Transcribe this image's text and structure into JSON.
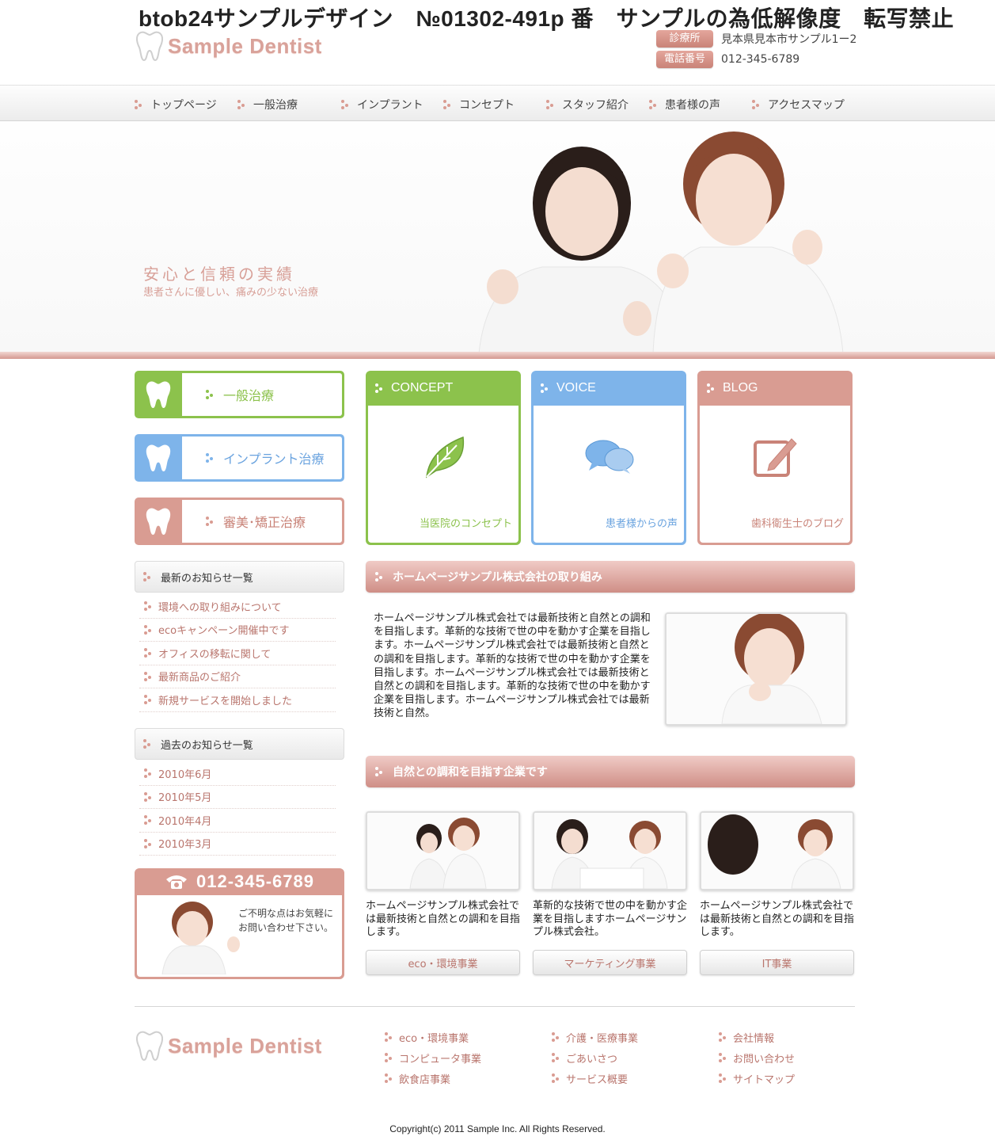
{
  "header": {
    "watermark_title": "btob24サンプルデザイン　№01302-491p 番　サンプルの為低解像度　転写禁止",
    "logo_text": "Sample Dentist",
    "clinic_label": "診療所",
    "clinic_address": "見本県見本市サンプル1ー2",
    "phone_label": "電話番号",
    "phone_number": "012-345-6789"
  },
  "nav": {
    "items": [
      "トップページ",
      "一般治療",
      "インプラント",
      "コンセプト",
      "スタッフ紹介",
      "患者様の声",
      "アクセスマップ"
    ]
  },
  "hero": {
    "title": "安心と信頼の実績",
    "subtitle": "患者さんに優しい、痛みの少ない治療"
  },
  "categories": [
    {
      "label": "一般治療",
      "color": "#8cc24c"
    },
    {
      "label": "インプラント治療",
      "color": "#7eb4ea"
    },
    {
      "label": "審美･矯正治療",
      "color": "#d99c92"
    }
  ],
  "cards": [
    {
      "title": "CONCEPT",
      "caption": "当医院のコンセプト",
      "color": "#8cc24c",
      "icon": "leaf-icon"
    },
    {
      "title": "VOICE",
      "caption": "患者様からの声",
      "color": "#7eb4ea",
      "icon": "chat-bubbles-icon"
    },
    {
      "title": "BLOG",
      "caption": "歯科衛生士のブログ",
      "color": "#d99c92",
      "icon": "edit-note-icon"
    }
  ],
  "news": {
    "latest_title": "最新のお知らせ一覧",
    "latest_items": [
      "環境への取り組みについて",
      "ecoキャンペーン開催中です",
      "オフィスの移転に関して",
      "最新商品のご紹介",
      "新規サービスを開始しました"
    ],
    "past_title": "過去のお知らせ一覧",
    "past_items": [
      "2010年6月",
      "2010年5月",
      "2010年4月",
      "2010年3月"
    ]
  },
  "contact": {
    "phone": "012-345-6789",
    "message": "ご不明な点はお気軽にお問い合わせ下さい。"
  },
  "section1": {
    "title": "ホームページサンプル株式会社の取り組み",
    "text": "ホームページサンプル株式会社では最新技術と自然との調和を目指します。革新的な技術で世の中を動かす企業を目指します。ホームページサンプル株式会社では最新技術と自然との調和を目指します。革新的な技術で世の中を動かす企業を目指します。ホームページサンプル株式会社では最新技術と自然との調和を目指します。革新的な技術で世の中を動かす企業を目指します。ホームページサンプル株式会社では最新技術と自然。"
  },
  "section2": {
    "title": "自然との調和を目指す企業です",
    "items": [
      {
        "text": "ホームページサンプル株式会社では最新技術と自然との調和を目指します。",
        "button": "eco・環境事業"
      },
      {
        "text": "革新的な技術で世の中を動かす企業を目指しますホームページサンプル株式会社。",
        "button": "マーケティング事業"
      },
      {
        "text": "ホームページサンプル株式会社では最新技術と自然との調和を目指します。",
        "button": "IT事業"
      }
    ]
  },
  "footer": {
    "logo_text": "Sample Dentist",
    "col1": [
      "eco・環境事業",
      "コンピュータ事業",
      "飲食店事業"
    ],
    "col2": [
      "介護・医療事業",
      "ごあいさつ",
      "サービス概要"
    ],
    "col3": [
      "会社情報",
      "お問い合わせ",
      "サイトマップ"
    ],
    "copyright": "Copyright(c) 2011 Sample Inc. All Rights Reserved."
  }
}
